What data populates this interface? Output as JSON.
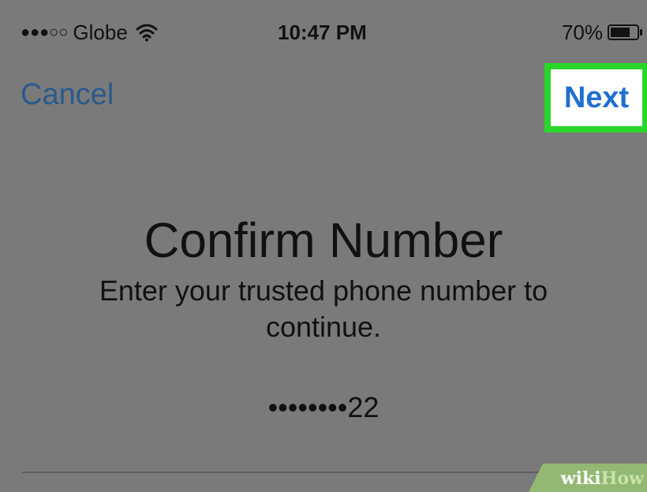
{
  "status_bar": {
    "signal_dots": "●●●○○",
    "carrier": "Globe",
    "time": "10:47 PM",
    "battery": "70%",
    "wifi_icon": "wifi-icon",
    "battery_icon": "battery-icon"
  },
  "nav": {
    "cancel_label": "Cancel",
    "next_label": "Next",
    "highlight_color": "#2ad62a",
    "link_color": "#1f6fd1"
  },
  "content": {
    "title": "Confirm Number",
    "subtitle": "Enter your trusted phone number to continue.",
    "masked_number": "••••••••22"
  },
  "watermark": {
    "part1": "wiki",
    "part2": "How"
  }
}
